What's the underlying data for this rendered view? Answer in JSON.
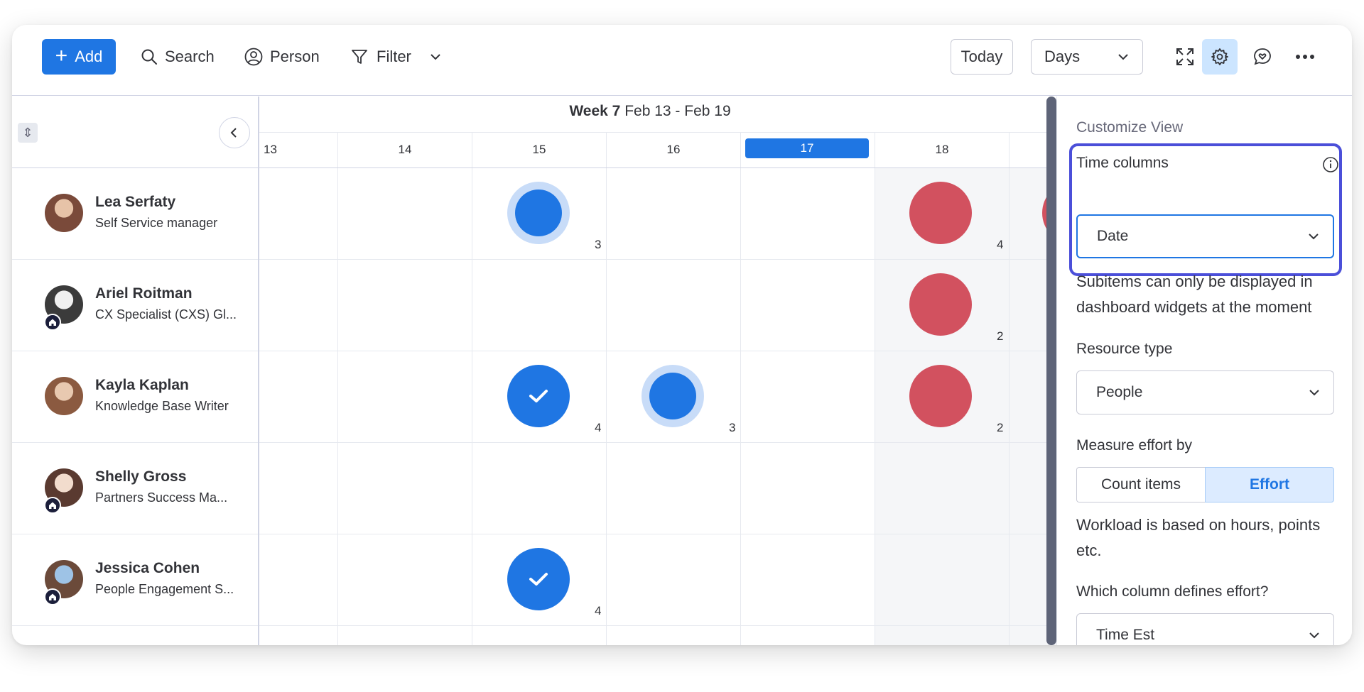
{
  "toolbar": {
    "add_label": "Add",
    "search_label": "Search",
    "person_label": "Person",
    "filter_label": "Filter",
    "today_label": "Today",
    "view_select": "Days"
  },
  "timeline": {
    "week_bold": "Week 7",
    "week_range": "Feb 13 - Feb 19",
    "days": [
      "13",
      "14",
      "15",
      "16",
      "17",
      "18"
    ],
    "today": "17"
  },
  "people": [
    {
      "name": "Lea Serfaty",
      "role": "Self Service manager",
      "badge": false,
      "avatar_color": "#7a4a3a",
      "avatar_accent": "#e7c3a8",
      "items": [
        {
          "day": "15",
          "color": "#1f76e3",
          "style": "halo",
          "count": "3"
        },
        {
          "day": "18",
          "color": "#d2515f",
          "style": "full",
          "count": "4"
        }
      ]
    },
    {
      "name": "Ariel Roitman",
      "role": "CX Specialist (CXS) Gl...",
      "badge": true,
      "avatar_color": "#3b3b3b",
      "avatar_accent": "#f0f0f0",
      "items": [
        {
          "day": "18",
          "color": "#d2515f",
          "style": "full",
          "count": "2"
        }
      ]
    },
    {
      "name": "Kayla Kaplan",
      "role": "Knowledge Base Writer",
      "badge": false,
      "avatar_color": "#8b5a40",
      "avatar_accent": "#e8c9b0",
      "items": [
        {
          "day": "15",
          "color": "#1f76e3",
          "style": "check",
          "count": "4"
        },
        {
          "day": "16",
          "color": "#1f76e3",
          "style": "halo",
          "count": "3"
        },
        {
          "day": "18",
          "color": "#d2515f",
          "style": "full",
          "count": "2"
        }
      ]
    },
    {
      "name": "Shelly Gross",
      "role": "Partners Success Ma...",
      "badge": true,
      "avatar_color": "#5a3a30",
      "avatar_accent": "#f2dccd",
      "items": []
    },
    {
      "name": "Jessica Cohen",
      "role": "People Engagement S...",
      "badge": true,
      "avatar_color": "#6b4a3a",
      "avatar_accent": "#9ec3e6",
      "items": [
        {
          "day": "15",
          "color": "#1f76e3",
          "style": "check",
          "count": "4"
        }
      ]
    }
  ],
  "panel": {
    "title": "Customize View",
    "time_columns_label": "Time columns",
    "time_columns_value": "Date",
    "subitems_note": "Subitems can only be displayed in dashboard widgets at the moment",
    "resource_type_label": "Resource type",
    "resource_type_value": "People",
    "measure_label": "Measure effort by",
    "measure_options": [
      "Count items",
      "Effort"
    ],
    "measure_selected": "Effort",
    "workload_note": "Workload is based on hours, points etc.",
    "effort_column_label": "Which column defines effort?",
    "effort_column_value": "Time Est"
  },
  "colors": {
    "accent": "#1f76e3",
    "overload": "#d2515f",
    "highlight_border": "#4b4fd9"
  }
}
